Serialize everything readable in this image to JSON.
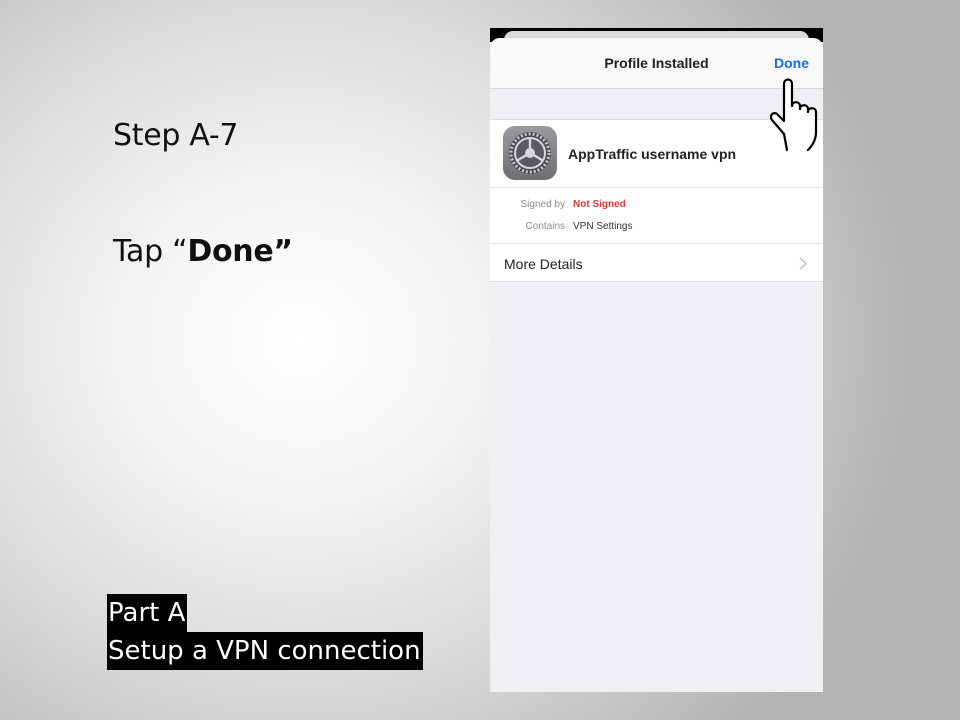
{
  "slide": {
    "step_title": "Step A-7",
    "instruction_prefix": "Tap “",
    "instruction_bold": "Done”",
    "part_label": "Part A",
    "part_subtitle": "Setup a VPN connection"
  },
  "phone": {
    "nav_title": "Profile Installed",
    "done_label": "Done",
    "profile": {
      "icon": "settings-gear-icon",
      "name": "AppTraffic username vpn",
      "signed_by_key": "Signed by",
      "signed_by_value": "Not Signed",
      "contains_key": "Contains",
      "contains_value": "VPN Settings",
      "more_details_label": "More Details"
    }
  },
  "colors": {
    "accent_blue": "#1a6fd6",
    "warning_red": "#e0373a"
  }
}
